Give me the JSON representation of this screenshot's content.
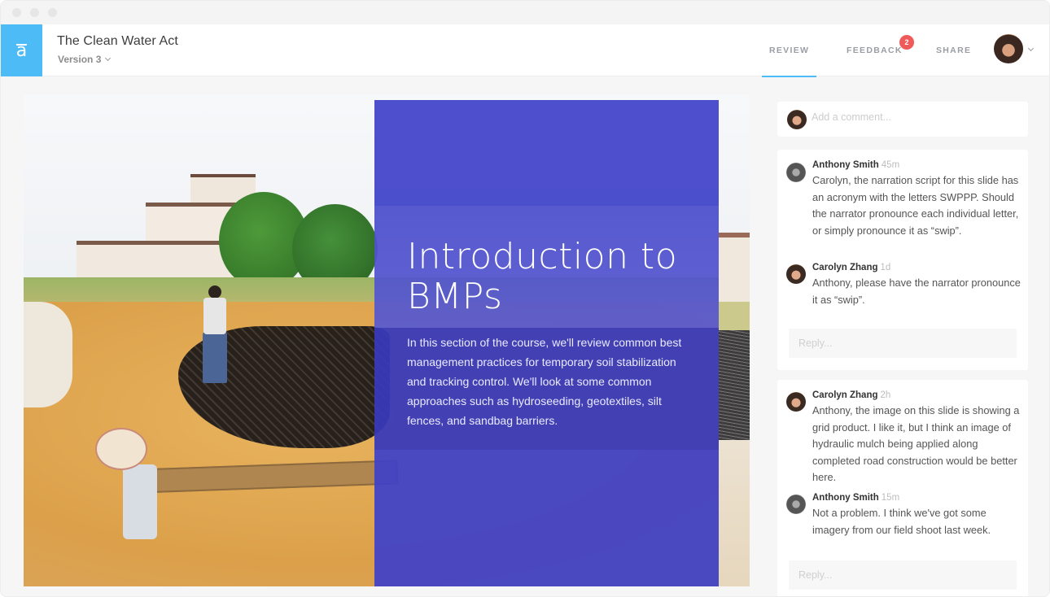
{
  "window": {
    "controls": [
      "close",
      "minimize",
      "maximize"
    ]
  },
  "header": {
    "logo_glyph": "a",
    "title": "The Clean Water Act",
    "version": "Version 3",
    "tabs": [
      {
        "label": "REVIEW",
        "active": true
      },
      {
        "label": "FEEDBACK",
        "badge": "2"
      },
      {
        "label": "SHARE"
      }
    ],
    "accent": "#4dbbf5",
    "badge_color": "#ef5a5a"
  },
  "slide": {
    "title": "Introduction to BMPs",
    "body": "In this section of the course, we'll review common best management practices for temporary soil stabilization and tracking control. We'll look at some common approaches such as hydroseeding, geotextiles, silt fences, and sandbag barriers.",
    "overlay_color": "#4042c8"
  },
  "comments": {
    "add_placeholder": "Add a comment...",
    "threads": [
      {
        "items": [
          {
            "author": "Anthony Smith",
            "time": "45m",
            "text": "Carolyn, the narration script for this slide has an acronym with the letters SWPPP. Should the narrator pronounce each individual letter, or simply pronounce it as “swip”."
          },
          {
            "author": "Carolyn Zhang",
            "time": "1d",
            "text": "Anthony, please have the narrator pronounce it as “swip”."
          }
        ],
        "reply_placeholder": "Reply..."
      },
      {
        "items": [
          {
            "author": "Carolyn Zhang",
            "time": "2h",
            "text": "Anthony, the image on this slide is showing a grid product. I like it, but I think an image of hydraulic mulch being applied along completed road construction would be better here."
          },
          {
            "author": "Anthony Smith",
            "time": "15m",
            "text": "Not a problem. I think we've got some imagery from our field shoot last week."
          }
        ],
        "reply_placeholder": "Reply..."
      }
    ]
  }
}
